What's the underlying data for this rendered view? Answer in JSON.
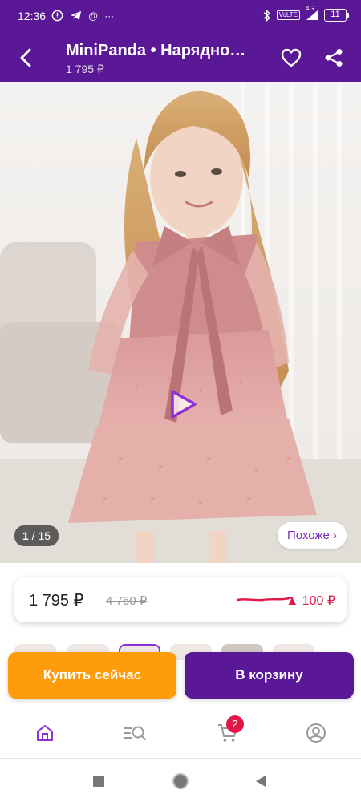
{
  "status_bar": {
    "time": "12:36",
    "network": "4G",
    "lte": "VoLTE",
    "battery": "11"
  },
  "header": {
    "title": "MiniPanda • Нарядно…",
    "price": "1 795 ₽"
  },
  "gallery": {
    "current": "1",
    "separator": " / ",
    "total": "15",
    "similar_label": "Похоже ›"
  },
  "price_card": {
    "current": "1 795 ₽",
    "old": "4 760 ₽",
    "delta": "▲ 100 ₽"
  },
  "actions": {
    "buy_now": "Купить сейчас",
    "add_to_cart": "В корзину"
  },
  "bottom_nav": {
    "cart_count": "2"
  },
  "colors": {
    "brand_purple": "#5a1796",
    "buy_orange": "#ff9c0b",
    "accent_red": "#e1174a",
    "similar_text": "#7b2cc0"
  },
  "icons": [
    "back-arrow-icon",
    "heart-icon",
    "share-icon",
    "play-icon",
    "home-icon",
    "catalog-search-icon",
    "cart-icon",
    "profile-icon"
  ]
}
